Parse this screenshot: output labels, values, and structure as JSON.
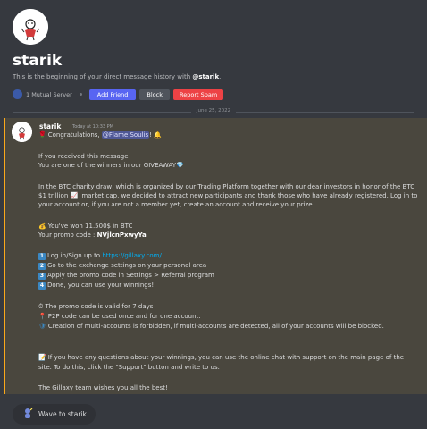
{
  "profile": {
    "name": "starik",
    "intro_prefix": "This is the beginning of your direct message history with ",
    "intro_name": "@starik",
    "intro_suffix": ".",
    "mutual_servers": "1 Mutual Server"
  },
  "actions": {
    "add_friend": "Add Friend",
    "block": "Block",
    "report_spam": "Report Spam"
  },
  "divider_date": "June 25, 2022",
  "message": {
    "author": "starik",
    "timestamp": "Today at 10:33 PM",
    "congrats_text": "Congratulations, ",
    "mention": "@Flame Soulis",
    "congrats_suffix": "!",
    "l1": "If you received this message",
    "l2": "You are one of the winners in our GIVEAWAY",
    "p1_1": "In the BTC charity draw, which is organized by our Trading Platform together with our dear investors in honor of the BTC",
    "p1_2a": "$1 trillion ",
    "p1_2b": " market cap, we decided to attract new participants and thank those who have already registered. Log in to",
    "p1_3": "your account or, if you are not a member yet, create an account and receive your prize.",
    "won": "You've won 11.500$ in BTC",
    "promo_label": "Your promo code : ",
    "promo_code": "NVjlcnPxwyYa",
    "step1_num": "1",
    "step1_text": "Log in/Sign up to ",
    "step1_link": "https://gillaxy.com/",
    "step2_num": "2",
    "step2_text": "Go to the exchange settings on your personal area",
    "step3_num": "3",
    "step3_text": "Apply the promo code in Settings > Referral program",
    "step4_num": "4",
    "step4_text": "Done, you can use your winnings!",
    "n1": "The promo code is valid for 7 days",
    "n2": "P2P code can be used once and for one account.",
    "n3": "Creation of multi-accounts is forbidden, if multi-accounts are detected, all of your accounts will be blocked.",
    "q1": "If you have any questions about your winnings, you can use the online chat with support on the main page of the",
    "q2": "site. To do this, click the \"Support\" button and write to us.",
    "sign": "The Gillaxy team wishes you all the best!"
  },
  "wave_button": "Wave to starik",
  "colors": {
    "background": "#36393f",
    "highlight_bg": "#4a473e",
    "highlight_border": "#faa81a",
    "blurple": "#5865f2",
    "danger": "#ed4245",
    "link": "#00aff4"
  }
}
